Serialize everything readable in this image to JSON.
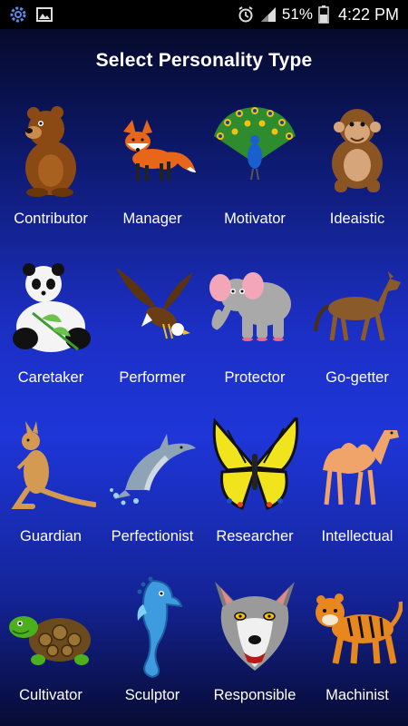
{
  "status_bar": {
    "left_icons": [
      "settings-gear-icon",
      "gallery-image-icon"
    ],
    "right_icons": [
      "alarm-icon",
      "signal-icon",
      "battery-icon"
    ],
    "battery": "51%",
    "time": "4:22 PM"
  },
  "header": {
    "title": "Select Personality Type"
  },
  "types": [
    {
      "label": "Contributor",
      "icon": "bear-icon"
    },
    {
      "label": "Manager",
      "icon": "fox-icon"
    },
    {
      "label": "Motivator",
      "icon": "peacock-icon"
    },
    {
      "label": "Ideaistic",
      "icon": "monkey-icon"
    },
    {
      "label": "Caretaker",
      "icon": "panda-icon"
    },
    {
      "label": "Performer",
      "icon": "eagle-icon"
    },
    {
      "label": "Protector",
      "icon": "elephant-icon"
    },
    {
      "label": "Go-getter",
      "icon": "horse-icon"
    },
    {
      "label": "Guardian",
      "icon": "kangaroo-icon"
    },
    {
      "label": "Perfectionist",
      "icon": "dolphin-icon"
    },
    {
      "label": "Researcher",
      "icon": "butterfly-icon"
    },
    {
      "label": "Intellectual",
      "icon": "camel-icon"
    },
    {
      "label": "Cultivator",
      "icon": "turtle-icon"
    },
    {
      "label": "Sculptor",
      "icon": "seahorse-icon"
    },
    {
      "label": "Responsible",
      "icon": "wolf-icon"
    },
    {
      "label": "Machinist",
      "icon": "tiger-icon"
    }
  ]
}
